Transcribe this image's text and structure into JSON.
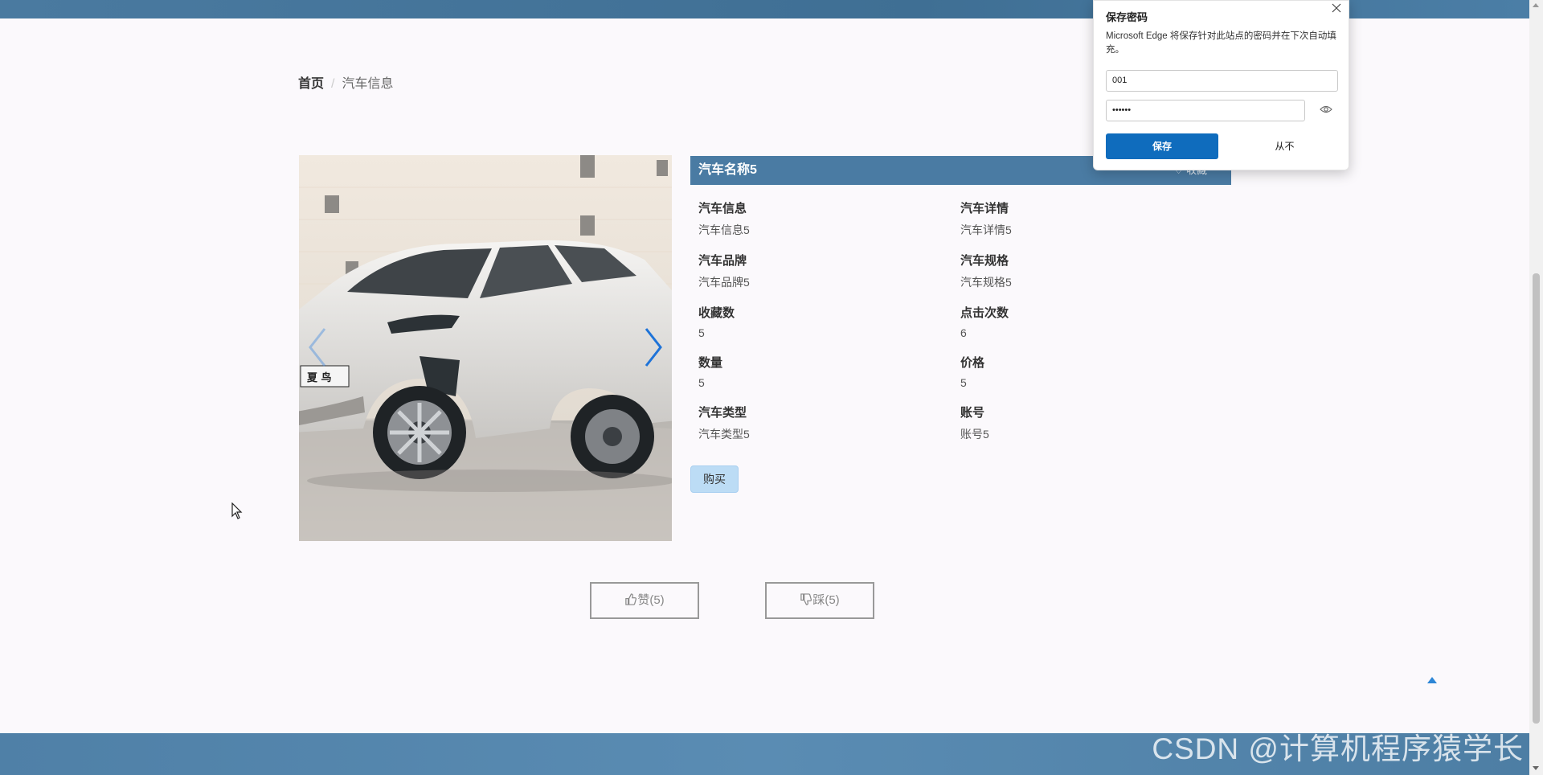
{
  "breadcrumb": {
    "home": "首页",
    "separator": "/",
    "current": "汽车信息"
  },
  "product": {
    "title": "汽车名称5",
    "favorite_label": "♡ 收藏",
    "fields": [
      {
        "label": "汽车信息",
        "value": "汽车信息5"
      },
      {
        "label": "汽车详情",
        "value": "汽车详情5"
      },
      {
        "label": "汽车品牌",
        "value": "汽车品牌5"
      },
      {
        "label": "汽车规格",
        "value": "汽车规格5"
      },
      {
        "label": "收藏数",
        "value": "5"
      },
      {
        "label": "点击次数",
        "value": "6"
      },
      {
        "label": "数量",
        "value": "5"
      },
      {
        "label": "价格",
        "value": "5"
      },
      {
        "label": "汽车类型",
        "value": "汽车类型5"
      },
      {
        "label": "账号",
        "value": "账号5"
      }
    ],
    "buy_label": "购买"
  },
  "carousel": {
    "plate_text": "夏 鸟",
    "prev_icon": "chevron-left-icon",
    "next_icon": "chevron-right-icon"
  },
  "votes": {
    "like_label": "赞(5)",
    "dislike_label": "踩(5)"
  },
  "watermark": "CSDN @计算机程序猿学长",
  "password_dialog": {
    "title": "保存密码",
    "description": "Microsoft Edge 将保存针对此站点的密码并在下次自动填充。",
    "username": "001",
    "password_masked": "••••••",
    "save_label": "保存",
    "never_label": "从不"
  },
  "colors": {
    "header_blue": "#4a7ba3",
    "accent_blue": "#0f6cbd",
    "buy_bg": "#bcdcf5"
  }
}
